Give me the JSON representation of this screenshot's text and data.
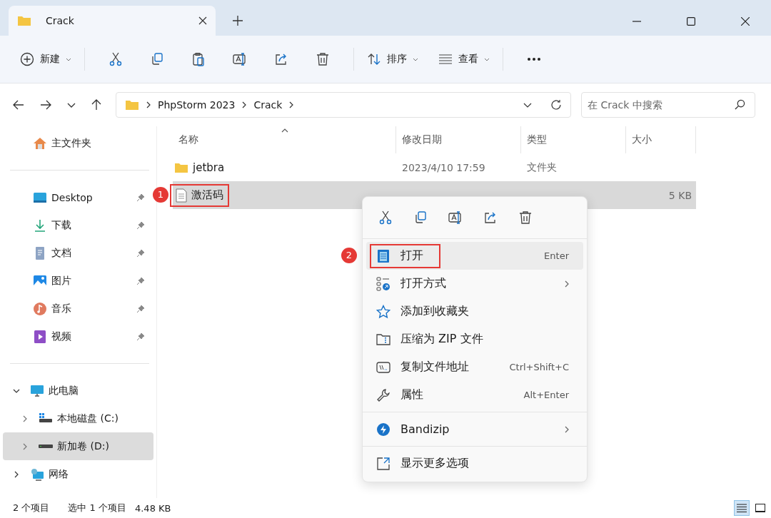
{
  "tab": {
    "title": "Crack"
  },
  "toolbar": {
    "new": "新建",
    "sort": "排序",
    "view": "查看"
  },
  "address": {
    "crumbs": [
      "PhpStorm 2023",
      "Crack"
    ]
  },
  "search": {
    "placeholder": "在 Crack 中搜索"
  },
  "sidebar": {
    "home": {
      "label": "主文件夹",
      "kind": "home"
    },
    "quick_access": [
      {
        "label": "Desktop",
        "kind": "desktop",
        "pinned": true
      },
      {
        "label": "下载",
        "kind": "download",
        "pinned": true
      },
      {
        "label": "文档",
        "kind": "document",
        "pinned": true
      },
      {
        "label": "图片",
        "kind": "pictures",
        "pinned": true
      },
      {
        "label": "音乐",
        "kind": "music",
        "pinned": true
      },
      {
        "label": "视频",
        "kind": "video",
        "pinned": true
      }
    ],
    "tree": [
      {
        "label": "此电脑",
        "kind": "pc",
        "expanded": true,
        "selected": false,
        "children": [
          {
            "label": "本地磁盘 (C:)",
            "kind": "system-drive",
            "expanded": false,
            "selected": false
          },
          {
            "label": "新加卷 (D:)",
            "kind": "drive",
            "expanded": false,
            "selected": true
          }
        ]
      },
      {
        "label": "网络",
        "kind": "network",
        "expanded": false,
        "selected": false
      }
    ]
  },
  "columns": [
    {
      "label": "名称",
      "sorted": true
    },
    {
      "label": "修改日期"
    },
    {
      "label": "类型"
    },
    {
      "label": "大小"
    }
  ],
  "rows": [
    {
      "name": "jetbra",
      "kind": "folder",
      "modified": "2023/4/10 17:59",
      "type": "文件夹",
      "selected": false
    },
    {
      "name": "激活码",
      "kind": "text",
      "size": "5 KB",
      "selected": true,
      "callout": "1"
    }
  ],
  "context_menu": {
    "groups": [
      [
        {
          "label": "打开",
          "kind": "notepad",
          "shortcut": "Enter",
          "highlighted": true,
          "callout": "2"
        },
        {
          "label": "打开方式",
          "kind": "open-with",
          "submenu": true,
          "highlighted": false
        },
        {
          "label": "添加到收藏夹",
          "kind": "star",
          "highlighted": false
        },
        {
          "label": "压缩为 ZIP 文件",
          "kind": "zip",
          "highlighted": false
        },
        {
          "label": "复制文件地址",
          "kind": "path",
          "shortcut": "Ctrl+Shift+C",
          "highlighted": false
        },
        {
          "label": "属性",
          "kind": "wrench",
          "shortcut": "Alt+Enter",
          "highlighted": false
        }
      ],
      [
        {
          "label": "Bandizip",
          "kind": "bandizip",
          "submenu": true,
          "highlighted": false
        }
      ],
      [
        {
          "label": "显示更多选项",
          "kind": "more",
          "highlighted": false
        }
      ]
    ]
  },
  "status_bar": {
    "count": "2 个项目",
    "selection": "选中 1 个项目",
    "size": "4.48 KB",
    "views": [
      {
        "kind": "details",
        "selected": true
      },
      {
        "kind": "tiles",
        "selected": false
      }
    ]
  }
}
